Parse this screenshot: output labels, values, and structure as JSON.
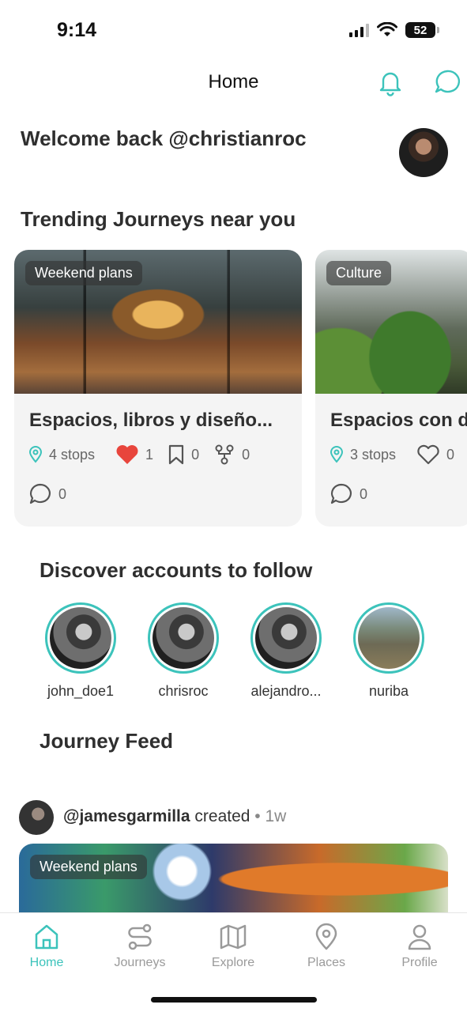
{
  "status": {
    "time": "9:14",
    "battery": "52"
  },
  "nav": {
    "title": "Home"
  },
  "welcome": {
    "text": "Welcome back @christianroc"
  },
  "trending": {
    "title": "Trending Journeys near you",
    "cards": [
      {
        "badge": "Weekend plans",
        "title": "Espacios, libros y diseño...",
        "stops": "4 stops",
        "likes": "1",
        "saves": "0",
        "forks": "0",
        "comments": "0",
        "liked": true
      },
      {
        "badge": "Culture",
        "title": "Espacios con d",
        "stops": "3 stops",
        "likes": "0",
        "comments": "0",
        "liked": false
      }
    ]
  },
  "discover": {
    "title": "Discover accounts to follow",
    "accounts": [
      {
        "name": "john_doe1"
      },
      {
        "name": "chrisroc"
      },
      {
        "name": "alejandro..."
      },
      {
        "name": "nuriba"
      }
    ]
  },
  "feed": {
    "title": "Journey Feed",
    "post": {
      "user": "@jamesgarmilla",
      "action": "created",
      "dot": "•",
      "time": "1w",
      "badge": "Weekend plans"
    }
  },
  "tabs": [
    {
      "label": "Home",
      "icon": "home-icon",
      "active": true
    },
    {
      "label": "Journeys",
      "icon": "route-icon"
    },
    {
      "label": "Explore",
      "icon": "map-icon"
    },
    {
      "label": "Places",
      "icon": "pin-icon"
    },
    {
      "label": "Profile",
      "icon": "user-icon"
    }
  ],
  "colors": {
    "accent": "#3cc3bb",
    "like": "#e8453c",
    "text": "#2f2f2f"
  }
}
